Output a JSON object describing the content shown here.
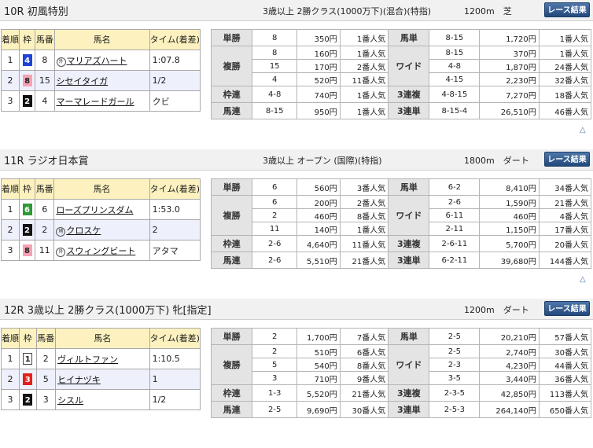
{
  "common": {
    "result_headers": [
      "着順",
      "枠",
      "馬番",
      "馬名",
      "タイム(着差)"
    ],
    "button_label": "レース結果",
    "top_icon": "△",
    "bet_types": [
      "単勝",
      "複勝",
      "枠連",
      "馬連",
      "馬単",
      "ワイド",
      "3連複",
      "3連単"
    ]
  },
  "races": [
    {
      "title": "10R 初風特別",
      "conditions": "3歳以上 2勝クラス(1000万下)(混合)(特指)",
      "distance": "1200m　芝",
      "results": [
        {
          "rank": "1",
          "waku": "4",
          "waku_bg": "#1f44d8",
          "waku_fg": "#ffffff",
          "num": "8",
          "mark": "外",
          "name": "マリアズハート",
          "time": "1:07.8"
        },
        {
          "rank": "2",
          "waku": "8",
          "waku_bg": "#f6a2b5",
          "waku_fg": "#222222",
          "num": "15",
          "mark": "",
          "name": "シセイタイガ",
          "time": "1/2"
        },
        {
          "rank": "3",
          "waku": "2",
          "waku_bg": "#111111",
          "waku_fg": "#ffffff",
          "num": "4",
          "mark": "",
          "name": "マーマレードガール",
          "time": "クビ"
        }
      ],
      "tansho": {
        "num": "8",
        "pay": "350円",
        "pop": "1番人気"
      },
      "fukusho": [
        {
          "num": "8",
          "pay": "160円",
          "pop": "1番人気"
        },
        {
          "num": "15",
          "pay": "170円",
          "pop": "2番人気"
        },
        {
          "num": "4",
          "pay": "520円",
          "pop": "11番人気"
        }
      ],
      "wakuren": {
        "num": "4-8",
        "pay": "740円",
        "pop": "1番人気"
      },
      "umaren": {
        "num": "8-15",
        "pay": "950円",
        "pop": "1番人気"
      },
      "umatan": {
        "num": "8-15",
        "pay": "1,720円",
        "pop": "1番人気"
      },
      "wide": [
        {
          "num": "8-15",
          "pay": "370円",
          "pop": "1番人気"
        },
        {
          "num": "4-8",
          "pay": "1,870円",
          "pop": "24番人気"
        },
        {
          "num": "4-15",
          "pay": "2,230円",
          "pop": "32番人気"
        }
      ],
      "sanrenpuku": {
        "num": "4-8-15",
        "pay": "7,270円",
        "pop": "18番人気"
      },
      "sanrentan": {
        "num": "8-15-4",
        "pay": "26,510円",
        "pop": "46番人気"
      }
    },
    {
      "title": "11R ラジオ日本賞",
      "conditions": "3歳以上 オープン (国際)(特指)",
      "distance": "1800m　ダート",
      "results": [
        {
          "rank": "1",
          "waku": "6",
          "waku_bg": "#2e9a36",
          "waku_fg": "#ffffff",
          "num": "6",
          "mark": "",
          "name": "ローズプリンスダム",
          "time": "1:53.0"
        },
        {
          "rank": "2",
          "waku": "2",
          "waku_bg": "#111111",
          "waku_fg": "#ffffff",
          "num": "2",
          "mark": "地",
          "name": "クロスケ",
          "time": "2"
        },
        {
          "rank": "3",
          "waku": "8",
          "waku_bg": "#f6a2b5",
          "waku_fg": "#222222",
          "num": "11",
          "mark": "外",
          "name": "スウィングビート",
          "time": "アタマ"
        }
      ],
      "tansho": {
        "num": "6",
        "pay": "560円",
        "pop": "3番人気"
      },
      "fukusho": [
        {
          "num": "6",
          "pay": "200円",
          "pop": "2番人気"
        },
        {
          "num": "2",
          "pay": "460円",
          "pop": "8番人気"
        },
        {
          "num": "11",
          "pay": "140円",
          "pop": "1番人気"
        }
      ],
      "wakuren": {
        "num": "2-6",
        "pay": "4,640円",
        "pop": "11番人気"
      },
      "umaren": {
        "num": "2-6",
        "pay": "5,510円",
        "pop": "21番人気"
      },
      "umatan": {
        "num": "6-2",
        "pay": "8,410円",
        "pop": "34番人気"
      },
      "wide": [
        {
          "num": "2-6",
          "pay": "1,590円",
          "pop": "21番人気"
        },
        {
          "num": "6-11",
          "pay": "460円",
          "pop": "4番人気"
        },
        {
          "num": "2-11",
          "pay": "1,150円",
          "pop": "17番人気"
        }
      ],
      "sanrenpuku": {
        "num": "2-6-11",
        "pay": "5,700円",
        "pop": "20番人気"
      },
      "sanrentan": {
        "num": "6-2-11",
        "pay": "39,680円",
        "pop": "144番人気"
      }
    },
    {
      "title": "12R 3歳以上 2勝クラス(1000万下) 牝[指定]",
      "conditions": "",
      "distance": "1200m　ダート",
      "results": [
        {
          "rank": "1",
          "waku": "1",
          "waku_bg": "#ffffff",
          "waku_fg": "#222222",
          "num": "2",
          "mark": "",
          "name": "ヴィルトファン",
          "time": "1:10.5"
        },
        {
          "rank": "2",
          "waku": "3",
          "waku_bg": "#e3201b",
          "waku_fg": "#ffffff",
          "num": "5",
          "mark": "",
          "name": "ヒイナヅキ",
          "time": "1"
        },
        {
          "rank": "3",
          "waku": "2",
          "waku_bg": "#111111",
          "waku_fg": "#ffffff",
          "num": "3",
          "mark": "",
          "name": "シスル",
          "time": "1/2"
        }
      ],
      "tansho": {
        "num": "2",
        "pay": "1,700円",
        "pop": "7番人気"
      },
      "fukusho": [
        {
          "num": "2",
          "pay": "510円",
          "pop": "6番人気"
        },
        {
          "num": "5",
          "pay": "540円",
          "pop": "8番人気"
        },
        {
          "num": "3",
          "pay": "710円",
          "pop": "9番人気"
        }
      ],
      "wakuren": {
        "num": "1-3",
        "pay": "5,520円",
        "pop": "21番人気"
      },
      "umaren": {
        "num": "2-5",
        "pay": "9,690円",
        "pop": "30番人気"
      },
      "umatan": {
        "num": "2-5",
        "pay": "20,210円",
        "pop": "57番人気"
      },
      "wide": [
        {
          "num": "2-5",
          "pay": "2,740円",
          "pop": "30番人気"
        },
        {
          "num": "2-3",
          "pay": "4,230円",
          "pop": "44番人気"
        },
        {
          "num": "3-5",
          "pay": "3,440円",
          "pop": "36番人気"
        }
      ],
      "sanrenpuku": {
        "num": "2-3-5",
        "pay": "42,850円",
        "pop": "113番人気"
      },
      "sanrentan": {
        "num": "2-5-3",
        "pay": "264,140円",
        "pop": "650番人気"
      }
    }
  ]
}
